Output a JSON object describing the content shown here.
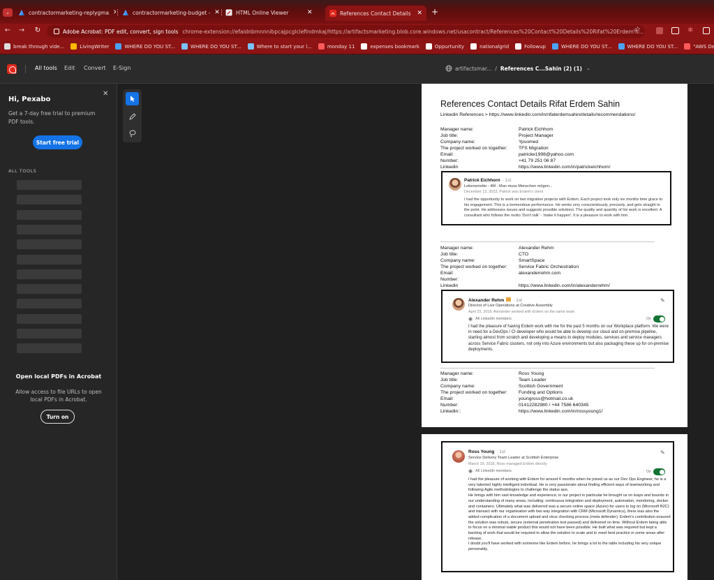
{
  "browser": {
    "tabs": [
      {
        "label": "contractormarketing-replygma",
        "active": false
      },
      {
        "label": "contractormarketing-budget - ",
        "active": false
      },
      {
        "label": "HTML Online Viewer",
        "active": false
      },
      {
        "label": "References Contact Details Rifat",
        "active": true
      }
    ],
    "new_tab_glyph": "+",
    "close_glyph": "✕",
    "address": {
      "site_label": "Adobe Acrobat: PDF edit, convert, sign tools",
      "url": "chrome-extension://efaidnbmnnnibpcajpcglclefindmkaj/https://artifactsmarketing.blob.core.windows.net/usacontract/References%20Contact%20Details%20Rifat%20Erdem%..."
    },
    "bookmarks": [
      {
        "label": "break through vide...",
        "color": "#dddddd"
      },
      {
        "label": "LivingWriter",
        "color": "#ffb900"
      },
      {
        "label": "WHERE DO YOU ST...",
        "color": "#4aa3ff"
      },
      {
        "label": "WHERE DO YOU ST...",
        "color": "#7ac1ff"
      },
      {
        "label": "Where to start your l...",
        "color": "#7ac1ff"
      },
      {
        "label": "monday 11",
        "color": "#ff5a5a"
      },
      {
        "label": "expenses bookmark",
        "color": "#ffffff"
      },
      {
        "label": "Oppurtunity",
        "color": "#ffffff"
      },
      {
        "label": "nationalgrid",
        "color": "#ffffff"
      },
      {
        "label": "Followup",
        "color": "#ffffff"
      },
      {
        "label": "WHERE DO YOU ST...",
        "color": "#4aa3ff"
      },
      {
        "label": "WHERE DO YOU ST...",
        "color": "#4aa3ff"
      },
      {
        "label": "\"AWS DevOps En",
        "color": "#ff5a5a"
      }
    ]
  },
  "acrobat": {
    "menu": [
      "All tools",
      "Edit",
      "Convert",
      "E-Sign"
    ],
    "doc_breadcrumb": {
      "location": "artifactsmar...",
      "separator": "/",
      "name": "References C...Sahin (2) (1)"
    },
    "sidebar": {
      "greeting": "Hi, Pexabo",
      "trial_text": "Get a 7-day free trial to premium PDF tools.",
      "trial_button": "Start free trial",
      "all_tools_label": "ALL TOOLS",
      "open_local_title": "Open local PDFs in Acrobat",
      "open_local_text": "Allow access to file URLs to open local PDFs in Acrobat.",
      "turn_on_button": "Turn on"
    }
  },
  "document": {
    "title": "References Contact Details Rifat Erdem Sahin",
    "subtitle": "Linkedin References > https://www.linkedin.com/in/rifaterdemsahin/details/recommendations/",
    "references": [
      {
        "fields": [
          [
            "Manager name:",
            "Patrick Eichhorn"
          ],
          [
            "Job title:",
            "Project Manager"
          ],
          [
            "Company name:",
            "Ypsomed"
          ],
          [
            "The project worked on together:",
            "TFS Migration"
          ],
          [
            "Email:",
            "patricke1998@yahoo.com"
          ],
          [
            "Number:",
            "+41 79 251 06 87"
          ],
          [
            "Linkedin",
            "https://www.linkedin.com/in/patrickeichhorn/"
          ]
        ],
        "card": {
          "name": "Patrick Eichhorn",
          "degree": "· 1st",
          "headline": "Lebensmotto - 4M - Man muss Menschen mögen...",
          "date": "December 12, 2023, Patrick was Erdem's client",
          "text": "I had the opportunity to work on two migration projects with Erdem. Each project took only six months time grace to his engagement. This is a tremendous performance. He works very conscientiously, precisely, and gets straight to the point. He addresses issues and suggests possible solutions. The quality and quantity of his work is excellent. A consultant who follows the motto 'Don't talk' - 'make it happen'. It is a pleasure to work with him."
        }
      },
      {
        "fields": [
          [
            "Manager name:",
            "Alexander Rehm"
          ],
          [
            "Job title:",
            "CTO"
          ],
          [
            "Company name:",
            "SmartSpace"
          ],
          [
            "The project worked on together:",
            "Service Fabric Orchestration"
          ],
          [
            "Email:",
            "alexanderrehm.com"
          ],
          [
            "Number:",
            ""
          ],
          [
            "Linkedin",
            "https://www.linkedin.com/in/alexanderrehm/"
          ]
        ],
        "card": {
          "name": "Alexander Rehm",
          "degree": "· 1st",
          "headline": "Director of Live Operations at Creative Assembly",
          "date": "April 23, 2018, Alexander worked with Erdem on the same team",
          "visibility": "All LinkedIn members",
          "toggle_label": "On",
          "text": "I had the pleasure of having Erdem work with me for the past 5 months on our Workplace platform. We were in need for a DevOps / CI developer who would be able to develop our cloud and on-premise pipeline, starting almost from scratch and developing a means to deploy modules, services and service managers across Service Fabric clusters, not only into Azure environments but also packaging these up for on-premise deployments."
        }
      },
      {
        "fields": [
          [
            "Manager name:",
            "Ross Young"
          ],
          [
            "Job title:",
            "Team Leader"
          ],
          [
            "Company name:",
            "Scottish Government"
          ],
          [
            "The project worked on together:",
            "Funding and Options"
          ],
          [
            "Email:",
            "youngross@hotmail.co.uk"
          ],
          [
            "Number:",
            "01412282980 / +44 7586 640345"
          ],
          [
            "Linkedin::",
            "https://www.linkedin.com/in/rossyoung1/"
          ]
        ],
        "card": {
          "name": "Ross Young",
          "degree": "· 1st",
          "headline": "Service Delivery Team Leader at Scottish Enterprise",
          "date": "March 19, 2018, Ross managed Erdem directly",
          "visibility": "All LinkedIn members",
          "toggle_label": "On",
          "paragraphs": [
            "I had the pleasure of working with Erdem for around 6 months when he joined us as our Dev Ops Engineer, he is a very talented highly intelligent individual. He is very passionate about finding efficient ways of teamworking and following Agile methodologies to challenge the status quo.",
            "He brings with him vast knowledge and experience, in our project in particular he brought us on leaps and bounds in our understanding of many areas, including; continuous integration and deployment, automation, monitoring, docker and containers. Ultimately what was delivered was a secure online space (Azure) for users to log on (Microsoft B2C) and transact with our organisation with two way integration with CRM (Microsoft Dynamics), there was also the added complication of a document upload and virus checking process (meta defender). Erdem's contribution ensured the solution was robust, secure (external penetration test passed) and delivered on time. Without Erdem being able to focus on a minimal viable product this would not have been possible. He built what was required but kept a backlog of work that would be required to allow the solution to scale and to meet best practice in some areas after release.",
            "I doubt you'll have worked with someone like Erdem before, he brings a lot to the table including his very unique personality."
          ]
        }
      }
    ]
  },
  "colors": {
    "browser_theme": "#8c1414",
    "acrobat_accent": "#1473e6",
    "toggle_on": "#137333",
    "acrobat_red": "#e0281c"
  }
}
